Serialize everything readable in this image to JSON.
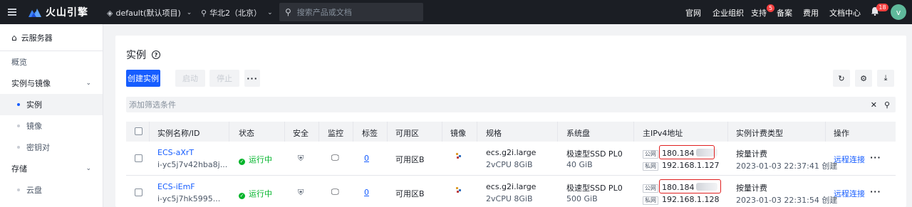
{
  "topbar": {
    "brand": "火山引擎",
    "project": "default(默认项目)",
    "region": "华北2（北京）",
    "search_placeholder": "搜索产品或文档",
    "links": {
      "official": "官网",
      "org": "企业组织",
      "support": "支持",
      "support_badge": "5",
      "filing": "备案",
      "billing": "费用",
      "docs": "文档中心"
    },
    "notification_badge": "18",
    "avatar": "v"
  },
  "sidebar": {
    "title": "云服务器",
    "items": {
      "overview": "概览",
      "instances_group": "实例与镜像",
      "instances": "实例",
      "images": "镜像",
      "keypairs": "密钥对",
      "storage_group": "存储",
      "disks": "云盘"
    }
  },
  "page": {
    "title": "实例",
    "toolbar": {
      "create": "创建实例",
      "start": "启动",
      "stop": "停止",
      "more": "···"
    },
    "filter_placeholder": "添加筛选条件"
  },
  "table": {
    "headers": {
      "name": "实例名称/ID",
      "status": "状态",
      "security": "安全",
      "monitor": "监控",
      "tags": "标签",
      "zone": "可用区",
      "image": "镜像",
      "spec": "规格",
      "disk": "系统盘",
      "ip": "主IPv4地址",
      "billing": "实例计费类型",
      "ops": "操作"
    },
    "rows": [
      {
        "name": "ECS-aXrT",
        "id": "i-yc5j7v42hba8j...",
        "status": "运行中",
        "tags": "0",
        "zone": "可用区B",
        "spec": "ecs.g2i.large",
        "spec_detail": "2vCPU   8GiB",
        "disk": "极速型SSD PL0",
        "disk_size": "40 GiB",
        "public_label": "公网",
        "public_ip": "180.184",
        "private_label": "私网",
        "private_ip": "192.168.1.127",
        "billing": "按量计费",
        "created": "2023-01-03 22:37:41 创建",
        "connect": "远程连接",
        "more": "···"
      },
      {
        "name": "ECS-iEmF",
        "id": "i-yc5j7hk5995...",
        "status": "运行中",
        "tags": "0",
        "zone": "可用区B",
        "spec": "ecs.g2i.large",
        "spec_detail": "2vCPU   8GiB",
        "disk": "极速型SSD PL0",
        "disk_size": "500 GiB",
        "public_label": "公网",
        "public_ip": "180.184",
        "private_label": "私网",
        "private_ip": "192.168.1.128",
        "billing": "按量计费",
        "created": "2023-01-03 22:31:54 创建",
        "connect": "远程连接",
        "more": "···"
      }
    ]
  }
}
